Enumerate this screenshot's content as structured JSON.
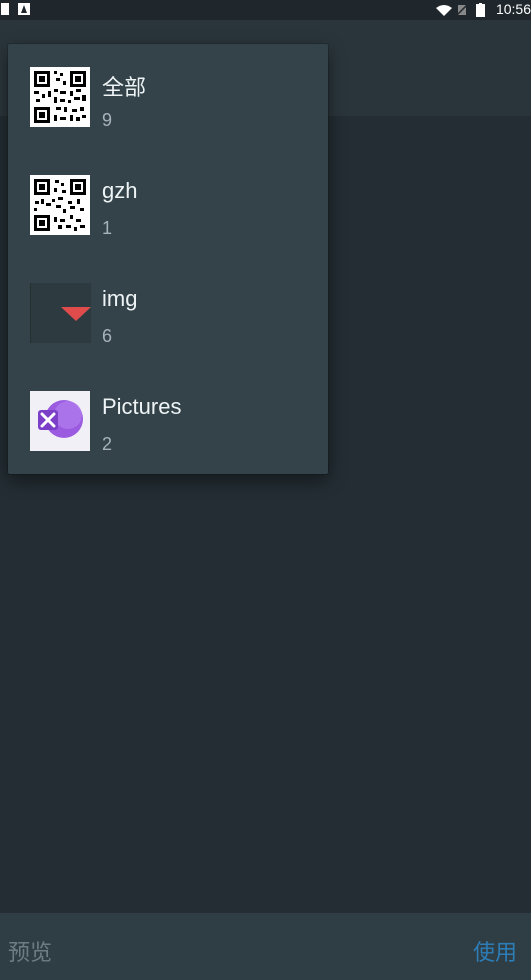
{
  "status_bar": {
    "time": "10:56"
  },
  "album_list": {
    "items": [
      {
        "name": "全部",
        "count": "9",
        "thumb": "qr-code-thumbnail"
      },
      {
        "name": "gzh",
        "count": "1",
        "thumb": "qr-code-thumbnail"
      },
      {
        "name": "img",
        "count": "6",
        "thumb": "red-triangle-thumbnail"
      },
      {
        "name": "Pictures",
        "count": "2",
        "thumb": "purple-logo-thumbnail"
      }
    ]
  },
  "bottom_bar": {
    "preview_label": "预览",
    "use_label": "使用"
  },
  "colors": {
    "background": "#232d33",
    "dropdown": "#334349",
    "accent_blue": "#2d7db7",
    "triangle_red": "#e04c4c",
    "logo_purple": "#8a46d6"
  }
}
